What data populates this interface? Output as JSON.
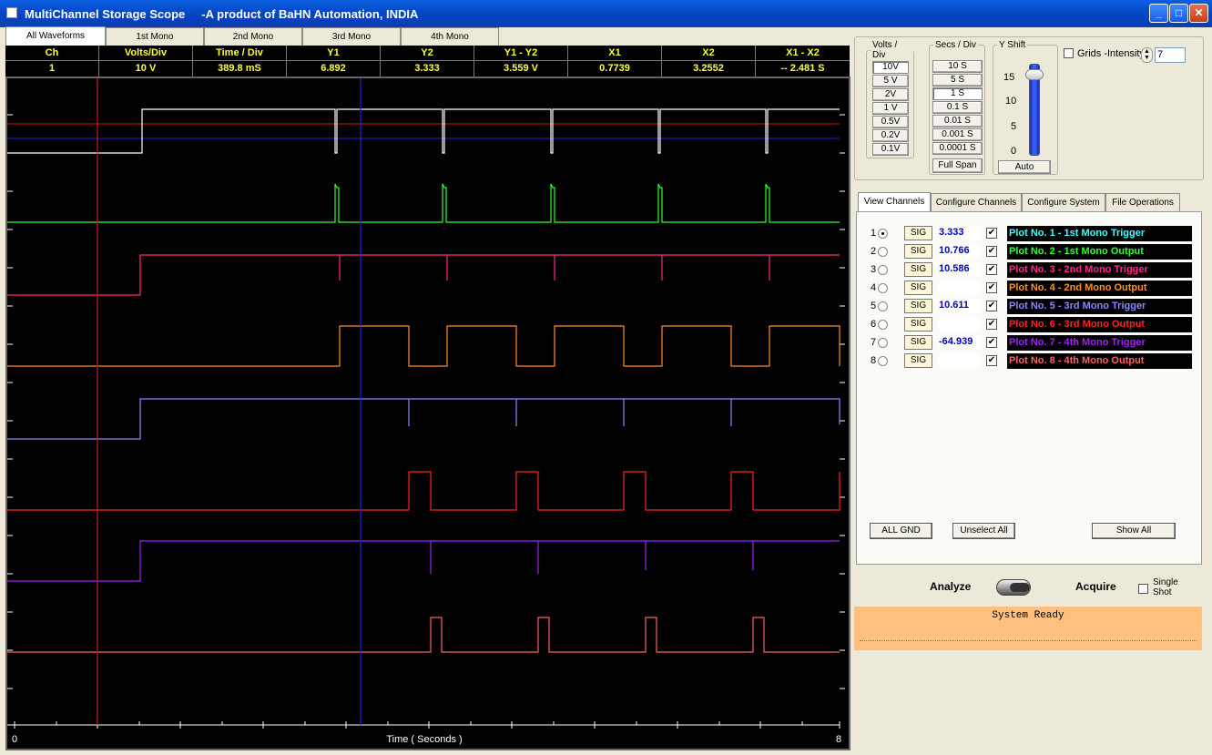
{
  "window": {
    "title": "MultiChannel Storage Scope     -A product of BaHN Automation, INDIA",
    "controls": {
      "minimize": "_",
      "maximize": "□",
      "close": "✕"
    }
  },
  "waveform_tabs": [
    "All Waveforms",
    "1st Mono",
    "2nd Mono",
    "3rd Mono",
    "4th Mono"
  ],
  "info_table": {
    "headers": [
      "Ch",
      "Volts/Div",
      "Time / Div",
      "Y1",
      "Y2",
      "Y1 - Y2",
      "X1",
      "X2",
      "X1 - X2"
    ],
    "values": [
      "1",
      "10 V",
      "389.8 mS",
      "6.892",
      "3.333",
      "3.559 V",
      "0.7739",
      "3.2552",
      "-- 2.481 S"
    ]
  },
  "plot": {
    "x_axis_label": "Time ( Seconds )",
    "x_min_label": "0",
    "x_max_label": "8",
    "cursor_colors": {
      "x1": "#d01818",
      "x2": "#2020e0",
      "y1": "#d01818",
      "y2": "#2020e0"
    }
  },
  "volts_div": {
    "legend": "Volts / Div",
    "options": [
      "10V",
      "5 V",
      "2V",
      "1 V",
      "0.5V",
      "0.2V",
      "0.1V"
    ],
    "selected": "10V"
  },
  "secs_div": {
    "legend": "Secs / Div",
    "options": [
      "10 S",
      "5 S",
      "1 S",
      "0.1 S",
      "0.01 S",
      "0.001 S",
      "0.0001 S"
    ],
    "selected": "1 S",
    "full_span": "Full Span"
  },
  "y_shift": {
    "legend": "Y Shift",
    "ticks": [
      "15",
      "10",
      "5",
      "0"
    ],
    "auto": "Auto"
  },
  "grids": {
    "label": "Grids -Intensity",
    "value": "7"
  },
  "panel_tabs": [
    "View Channels",
    "Configure Channels",
    "Configure System",
    "File Operations"
  ],
  "channels": [
    {
      "num": "1",
      "sig": "SIG",
      "value": "3.333",
      "name": "Plot No. 1 - 1st Mono Trigger",
      "color": "#40ffff",
      "selected": true
    },
    {
      "num": "2",
      "sig": "SIG",
      "value": "10.766",
      "name": "Plot No. 2 - 1st Mono Output",
      "color": "#30ff30",
      "selected": false
    },
    {
      "num": "3",
      "sig": "SIG",
      "value": "10.586",
      "name": "Plot No. 3 - 2nd Mono Trigger",
      "color": "#ff2888",
      "selected": false
    },
    {
      "num": "4",
      "sig": "SIG",
      "value": "",
      "name": "Plot No. 4 - 2nd Mono Output",
      "color": "#ff9020",
      "selected": false
    },
    {
      "num": "5",
      "sig": "SIG",
      "value": "10.611",
      "name": "Plot No. 5 - 3rd Mono Trigger",
      "color": "#8888ff",
      "selected": false
    },
    {
      "num": "6",
      "sig": "SIG",
      "value": "",
      "name": "Plot No. 6 - 3rd Mono Output",
      "color": "#ff2020",
      "selected": false
    },
    {
      "num": "7",
      "sig": "SIG",
      "value": "-64.939",
      "name": "Plot No. 7 - 4th Mono Trigger",
      "color": "#a020ff",
      "selected": false
    },
    {
      "num": "8",
      "sig": "SIG",
      "value": "",
      "name": "Plot No. 8 - 4th Mono Output",
      "color": "#ff6060",
      "selected": false
    }
  ],
  "channel_buttons": {
    "all_gnd": "ALL GND",
    "unselect_all": "Unselect All",
    "show_all": "Show All"
  },
  "mode": {
    "analyze": "Analyze",
    "acquire": "Acquire",
    "single_shot": "Single Shot"
  },
  "status": "System Ready"
}
